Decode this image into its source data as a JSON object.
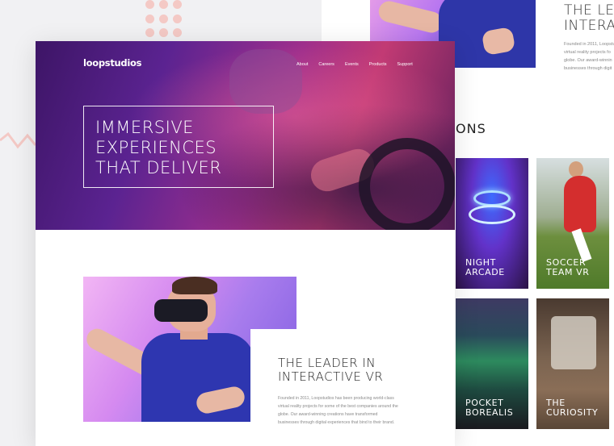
{
  "brand": {
    "logo": "loopstudios"
  },
  "nav": {
    "items": [
      "About",
      "Careers",
      "Events",
      "Products",
      "Support"
    ]
  },
  "hero": {
    "title_lines": [
      "IMMERSIVE",
      "EXPERIENCES",
      "THAT DELIVER"
    ]
  },
  "feature": {
    "title_lines": [
      "THE LEADER IN",
      "INTERACTIVE VR"
    ],
    "description_lines": [
      "Founded in 2011, Loopstudios has been producing world-class",
      "virtual reality projects for some of the best companies around the",
      "globe. Our award-winning creations have transformed",
      "businesses through digital experiences that bind to their brand."
    ]
  },
  "back_page": {
    "title_lines": [
      "THE LEA",
      "INTERA"
    ],
    "description_lines": [
      "Founded in 2011, Loopstu",
      "virtual reality projects fo",
      "globe. Our award-winnin",
      "businesses through digit"
    ],
    "section_heading": "ONS",
    "creations": [
      {
        "label_lines": [
          "NIGHT",
          "ARCADE"
        ]
      },
      {
        "label_lines": [
          "SOCCER",
          "TEAM VR"
        ]
      },
      {
        "label_lines": [
          "POCKET",
          "BOREALIS"
        ]
      },
      {
        "label_lines": [
          "THE",
          "CURIOSITY"
        ]
      }
    ]
  },
  "colors": {
    "decor_dots": "#f4c9c5",
    "hero_purple": "#5b2391",
    "text_dark": "#222222"
  }
}
